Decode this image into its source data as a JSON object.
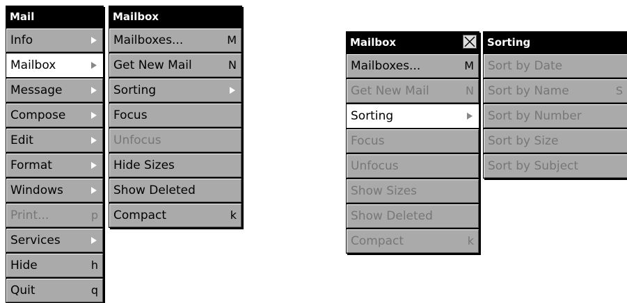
{
  "mail_menu": {
    "title": "Mail",
    "items": [
      {
        "label": "Info",
        "key": "",
        "submenu": true,
        "state": "normal"
      },
      {
        "label": "Mailbox",
        "key": "",
        "submenu": true,
        "state": "highlight"
      },
      {
        "label": "Message",
        "key": "",
        "submenu": true,
        "state": "normal"
      },
      {
        "label": "Compose",
        "key": "",
        "submenu": true,
        "state": "normal"
      },
      {
        "label": "Edit",
        "key": "",
        "submenu": true,
        "state": "normal"
      },
      {
        "label": "Format",
        "key": "",
        "submenu": true,
        "state": "normal"
      },
      {
        "label": "Windows",
        "key": "",
        "submenu": true,
        "state": "normal"
      },
      {
        "label": "Print...",
        "key": "p",
        "submenu": false,
        "state": "disabled"
      },
      {
        "label": "Services",
        "key": "",
        "submenu": true,
        "state": "normal"
      },
      {
        "label": "Hide",
        "key": "h",
        "submenu": false,
        "state": "normal"
      },
      {
        "label": "Quit",
        "key": "q",
        "submenu": false,
        "state": "normal"
      }
    ]
  },
  "mailbox_menu": {
    "title": "Mailbox",
    "items": [
      {
        "label": "Mailboxes...",
        "key": "M",
        "submenu": false,
        "state": "normal"
      },
      {
        "label": "Get New Mail",
        "key": "N",
        "submenu": false,
        "state": "normal"
      },
      {
        "label": "Sorting",
        "key": "",
        "submenu": true,
        "state": "normal"
      },
      {
        "label": "Focus",
        "key": "",
        "submenu": false,
        "state": "normal"
      },
      {
        "label": "Unfocus",
        "key": "",
        "submenu": false,
        "state": "disabled"
      },
      {
        "label": "Hide Sizes",
        "key": "",
        "submenu": false,
        "state": "normal"
      },
      {
        "label": "Show Deleted",
        "key": "",
        "submenu": false,
        "state": "normal"
      },
      {
        "label": "Compact",
        "key": "k",
        "submenu": false,
        "state": "normal"
      }
    ]
  },
  "mailbox_torn_menu": {
    "title": "Mailbox",
    "close_icon": "close-x",
    "items": [
      {
        "label": "Mailboxes...",
        "key": "M",
        "submenu": false,
        "state": "normal"
      },
      {
        "label": "Get New Mail",
        "key": "N",
        "submenu": false,
        "state": "disabled"
      },
      {
        "label": "Sorting",
        "key": "",
        "submenu": true,
        "state": "highlight"
      },
      {
        "label": "Focus",
        "key": "",
        "submenu": false,
        "state": "disabled"
      },
      {
        "label": "Unfocus",
        "key": "",
        "submenu": false,
        "state": "disabled"
      },
      {
        "label": "Show Sizes",
        "key": "",
        "submenu": false,
        "state": "disabled"
      },
      {
        "label": "Show Deleted",
        "key": "",
        "submenu": false,
        "state": "disabled"
      },
      {
        "label": "Compact",
        "key": "k",
        "submenu": false,
        "state": "disabled"
      }
    ]
  },
  "sorting_menu": {
    "title": "Sorting",
    "items": [
      {
        "label": "Sort by Date",
        "key": "",
        "submenu": false,
        "state": "disabled"
      },
      {
        "label": "Sort by Name",
        "key": "S",
        "submenu": false,
        "state": "disabled"
      },
      {
        "label": "Sort by Number",
        "key": "",
        "submenu": false,
        "state": "disabled"
      },
      {
        "label": "Sort by Size",
        "key": "",
        "submenu": false,
        "state": "disabled"
      },
      {
        "label": "Sort by Subject",
        "key": "",
        "submenu": false,
        "state": "disabled"
      }
    ]
  },
  "colors": {
    "title_bg": "#000000",
    "item_bg": "#aaaaaa",
    "highlight_bg": "#ffffff",
    "disabled_text": "#777777"
  }
}
